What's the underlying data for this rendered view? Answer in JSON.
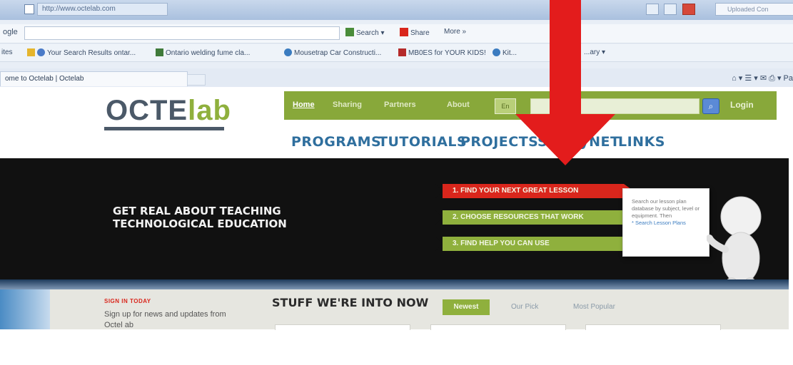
{
  "browser": {
    "address": "http://www.octelab.com",
    "search_placeholder": "Uploaded Con",
    "toolbar": {
      "label": "ogle",
      "search": "Search",
      "share": "Share",
      "more": "More »"
    },
    "favorites": [
      "ites",
      "Your Search Results  ontar...",
      "Ontario welding fume cla...",
      "Mousetrap Car Constructi...",
      "MB0ES for YOUR KIDS!",
      "Kit...",
      "...ary"
    ],
    "tab_title": "ome to Octelab | Octelab",
    "command_icons": "⌂ ▾  ☰ ▾  ✉  ⎙ ▾  Pa"
  },
  "site": {
    "logo_part1": "OCTE",
    "logo_part2": "lab",
    "topnav": [
      "Home",
      "Sharing",
      "Partners",
      "About"
    ],
    "lang": "En",
    "login": "Login",
    "mainnav": [
      "PROGRAMS",
      "TUTORIALS",
      "PROJECTS",
      "SafetyNET",
      "LINKS"
    ]
  },
  "hero": {
    "line1": "GET REAL ABOUT TEACHING",
    "line2": "TECHNOLOGICAL EDUCATION",
    "steps": [
      "1. FIND YOUR NEXT GREAT LESSON",
      "2. CHOOSE RESOURCES THAT WORK",
      "3. FIND HELP YOU CAN USE"
    ],
    "board_text": "Search our lesson plan database by subject, level or equipment. Then",
    "board_link": "* Search Lesson Plans"
  },
  "lower": {
    "signin_title": "SIGN IN TODAY",
    "signin_text": "Sign up for news and updates from Octel ab",
    "stuff_title": "STUFF WE'RE INTO NOW",
    "tabs": [
      "Newest",
      "Our Pick",
      "Most Popular"
    ]
  },
  "colors": {
    "nav_green": "#88a83a",
    "nav_blue": "#2f6f9e",
    "ribbon_red": "#d9261c",
    "arrow_red": "#e31c1c"
  }
}
